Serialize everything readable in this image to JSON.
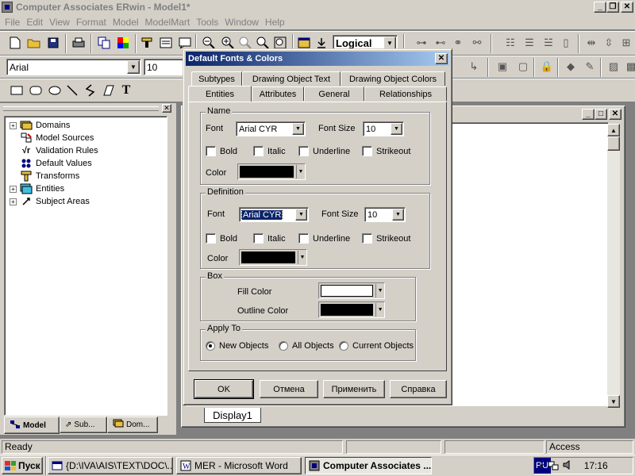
{
  "window": {
    "title": "Computer Associates ERwin - Model1*",
    "controls": [
      "_",
      "❐",
      "✕"
    ]
  },
  "menu": [
    "File",
    "Edit",
    "View",
    "Format",
    "Model",
    "ModelMart",
    "Tools",
    "Window",
    "Help"
  ],
  "toolbar": {
    "view_level": "Logical",
    "font_name": "Arial",
    "font_size": "10"
  },
  "explorer": {
    "tree": [
      {
        "label": "Domains",
        "expandable": true,
        "icon": "domains-icon"
      },
      {
        "label": "Model Sources",
        "expandable": false,
        "icon": "model-sources-icon"
      },
      {
        "label": "Validation Rules",
        "expandable": false,
        "icon": "validation-rules-icon"
      },
      {
        "label": "Default Values",
        "expandable": false,
        "icon": "default-values-icon"
      },
      {
        "label": "Transforms",
        "expandable": false,
        "icon": "transforms-icon"
      },
      {
        "label": "Entities",
        "expandable": true,
        "icon": "entities-icon"
      },
      {
        "label": "Subject Areas",
        "expandable": true,
        "icon": "subject-areas-icon"
      }
    ],
    "tabs": [
      "Model",
      "Sub...",
      "Dom..."
    ],
    "active_tab": "Model"
  },
  "model_window": {
    "display_tab": "Display1"
  },
  "dialog": {
    "title": "Default Fonts & Colors",
    "tabs_back": [
      "Subtypes",
      "Drawing Object Text",
      "Drawing Object Colors"
    ],
    "tabs_front": [
      "Entities",
      "Attributes",
      "General",
      "Relationships"
    ],
    "active_tab": "Entities",
    "name_group": {
      "title": "Name",
      "font_label": "Font",
      "font_value": "Arial CYR",
      "size_label": "Font Size",
      "size_value": "10",
      "bold": "Bold",
      "italic": "Italic",
      "underline": "Underline",
      "strikeout": "Strikeout",
      "color_label": "Color",
      "color": "#000000"
    },
    "definition_group": {
      "title": "Definition",
      "font_label": "Font",
      "font_value": "Arial CYR",
      "size_label": "Font Size",
      "size_value": "10",
      "bold": "Bold",
      "italic": "Italic",
      "underline": "Underline",
      "strikeout": "Strikeout",
      "color_label": "Color",
      "color": "#000000"
    },
    "box_group": {
      "title": "Box",
      "fill_label": "Fill Color",
      "fill_color": "#ffffff",
      "outline_label": "Outline Color",
      "outline_color": "#000000"
    },
    "apply_group": {
      "title": "Apply To",
      "options": [
        "New Objects",
        "All Objects",
        "Current Objects"
      ],
      "selected": "New Objects"
    },
    "buttons": {
      "ok": "OK",
      "cancel": "Отмена",
      "apply": "Применить",
      "help": "Справка"
    }
  },
  "statusbar": {
    "text": "Ready",
    "access": "Access"
  },
  "taskbar": {
    "start": "Пуск",
    "tasks": [
      {
        "label": "{D:\\IVA\\AIS\\TEXT\\DOC\\...",
        "active": false
      },
      {
        "label": "MER - Microsoft Word",
        "active": false
      },
      {
        "label": "Computer Associates ...",
        "active": true
      }
    ],
    "lang": "RU",
    "clock": "17:16"
  }
}
